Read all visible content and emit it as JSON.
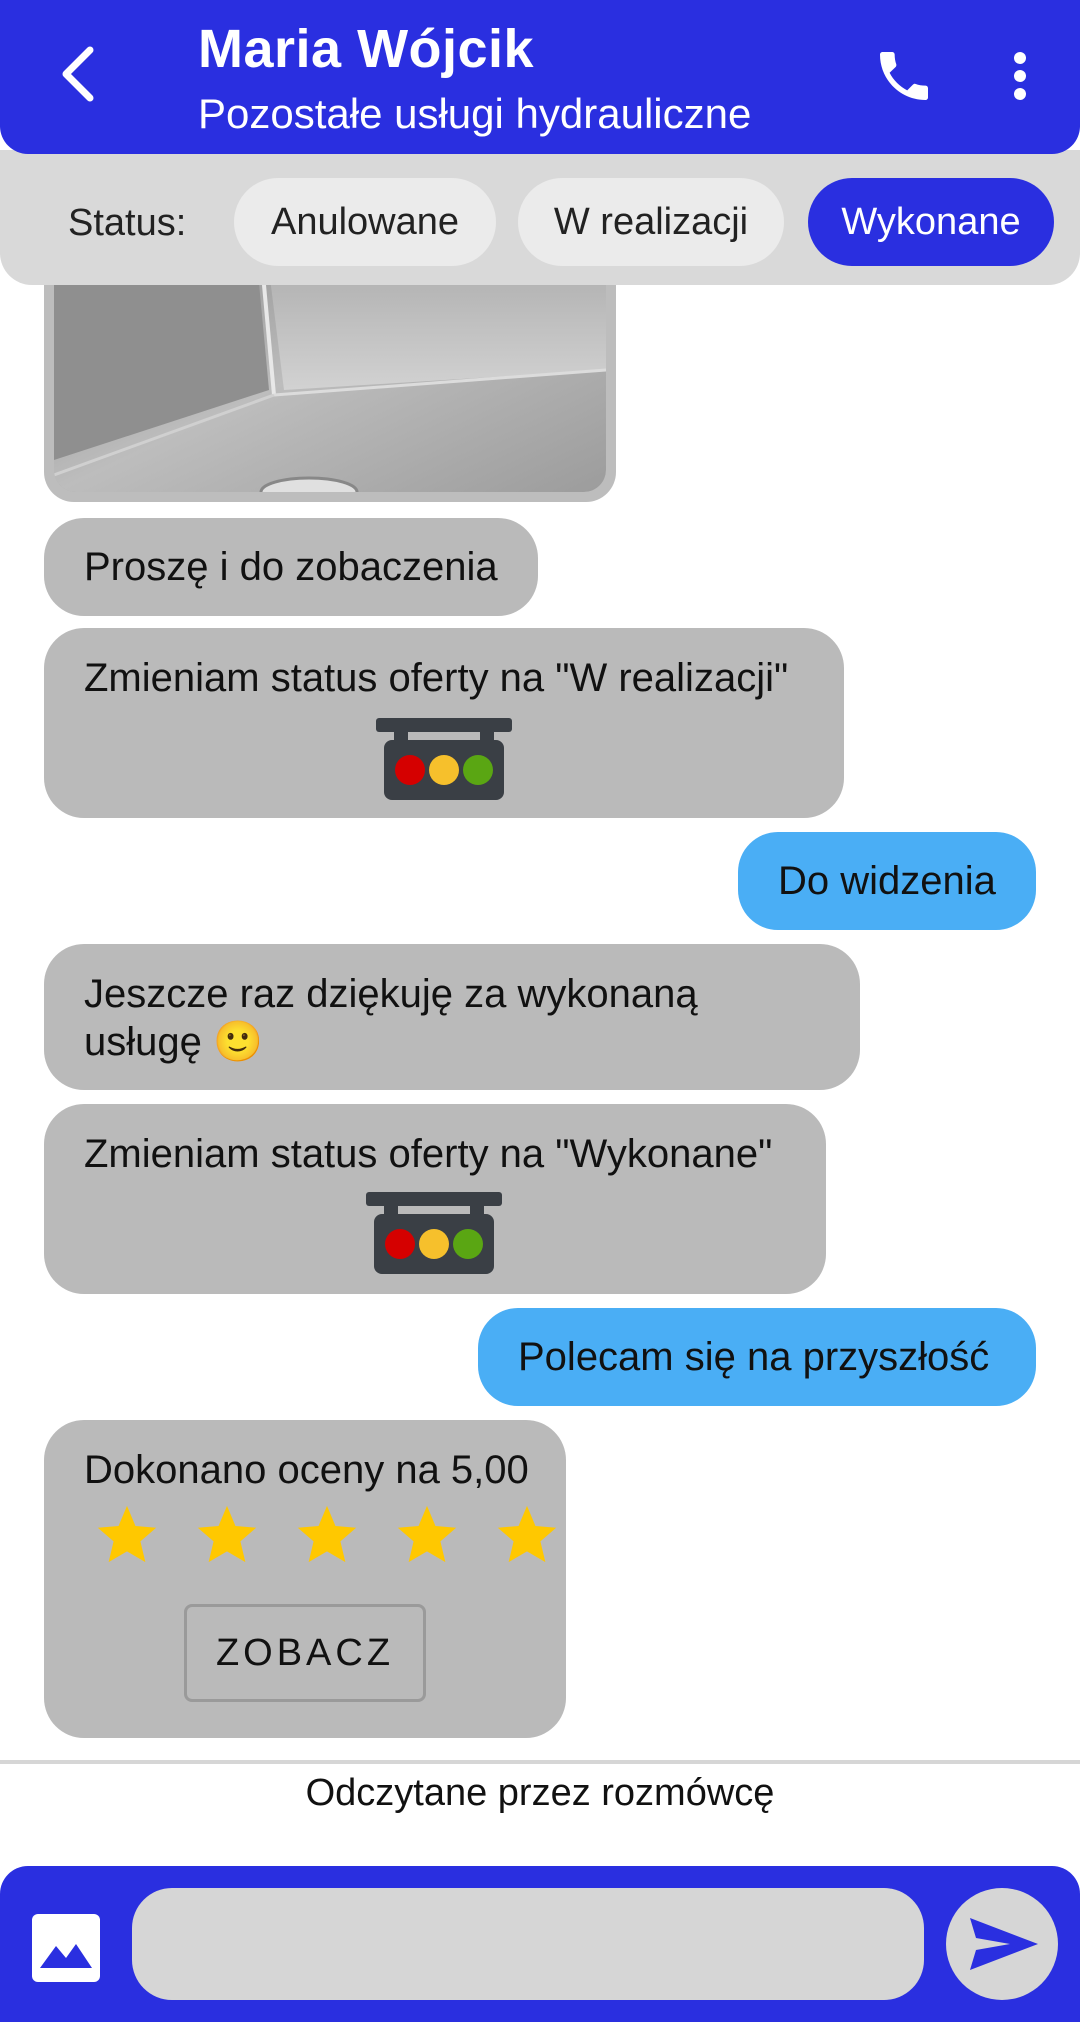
{
  "header": {
    "title": "Maria Wójcik",
    "subtitle": "Pozostałe usługi hydrauliczne",
    "back_icon": "chevron-left-icon",
    "call_icon": "phone-icon",
    "menu_icon": "more-vertical-icon"
  },
  "status": {
    "label": "Status:",
    "options": [
      "Anulowane",
      "W realizacji",
      "Wykonane"
    ],
    "selected": "Wykonane"
  },
  "messages": {
    "m1": "Proszę i do zobaczenia",
    "m2": "Zmieniam status oferty na \"W realizacji\"",
    "m3": "Do widzenia",
    "m4": "Jeszcze raz dziękuję za wykonaną usługę 🙂",
    "m5": "Zmieniam status oferty na \"Wykonane\"",
    "m6": "Polecam się na przyszłość"
  },
  "rating": {
    "text": "Dokonano oceny na 5,00",
    "value": 5,
    "max": 5,
    "button_label": "ZOBACZ"
  },
  "read_receipt": "Odczytane przez rozmówcę",
  "input": {
    "value": "",
    "placeholder": ""
  },
  "colors": {
    "brand": "#2a2fe0",
    "my_bubble": "#4aaef5",
    "their_bubble": "#bababa",
    "star": "#ffc800"
  }
}
